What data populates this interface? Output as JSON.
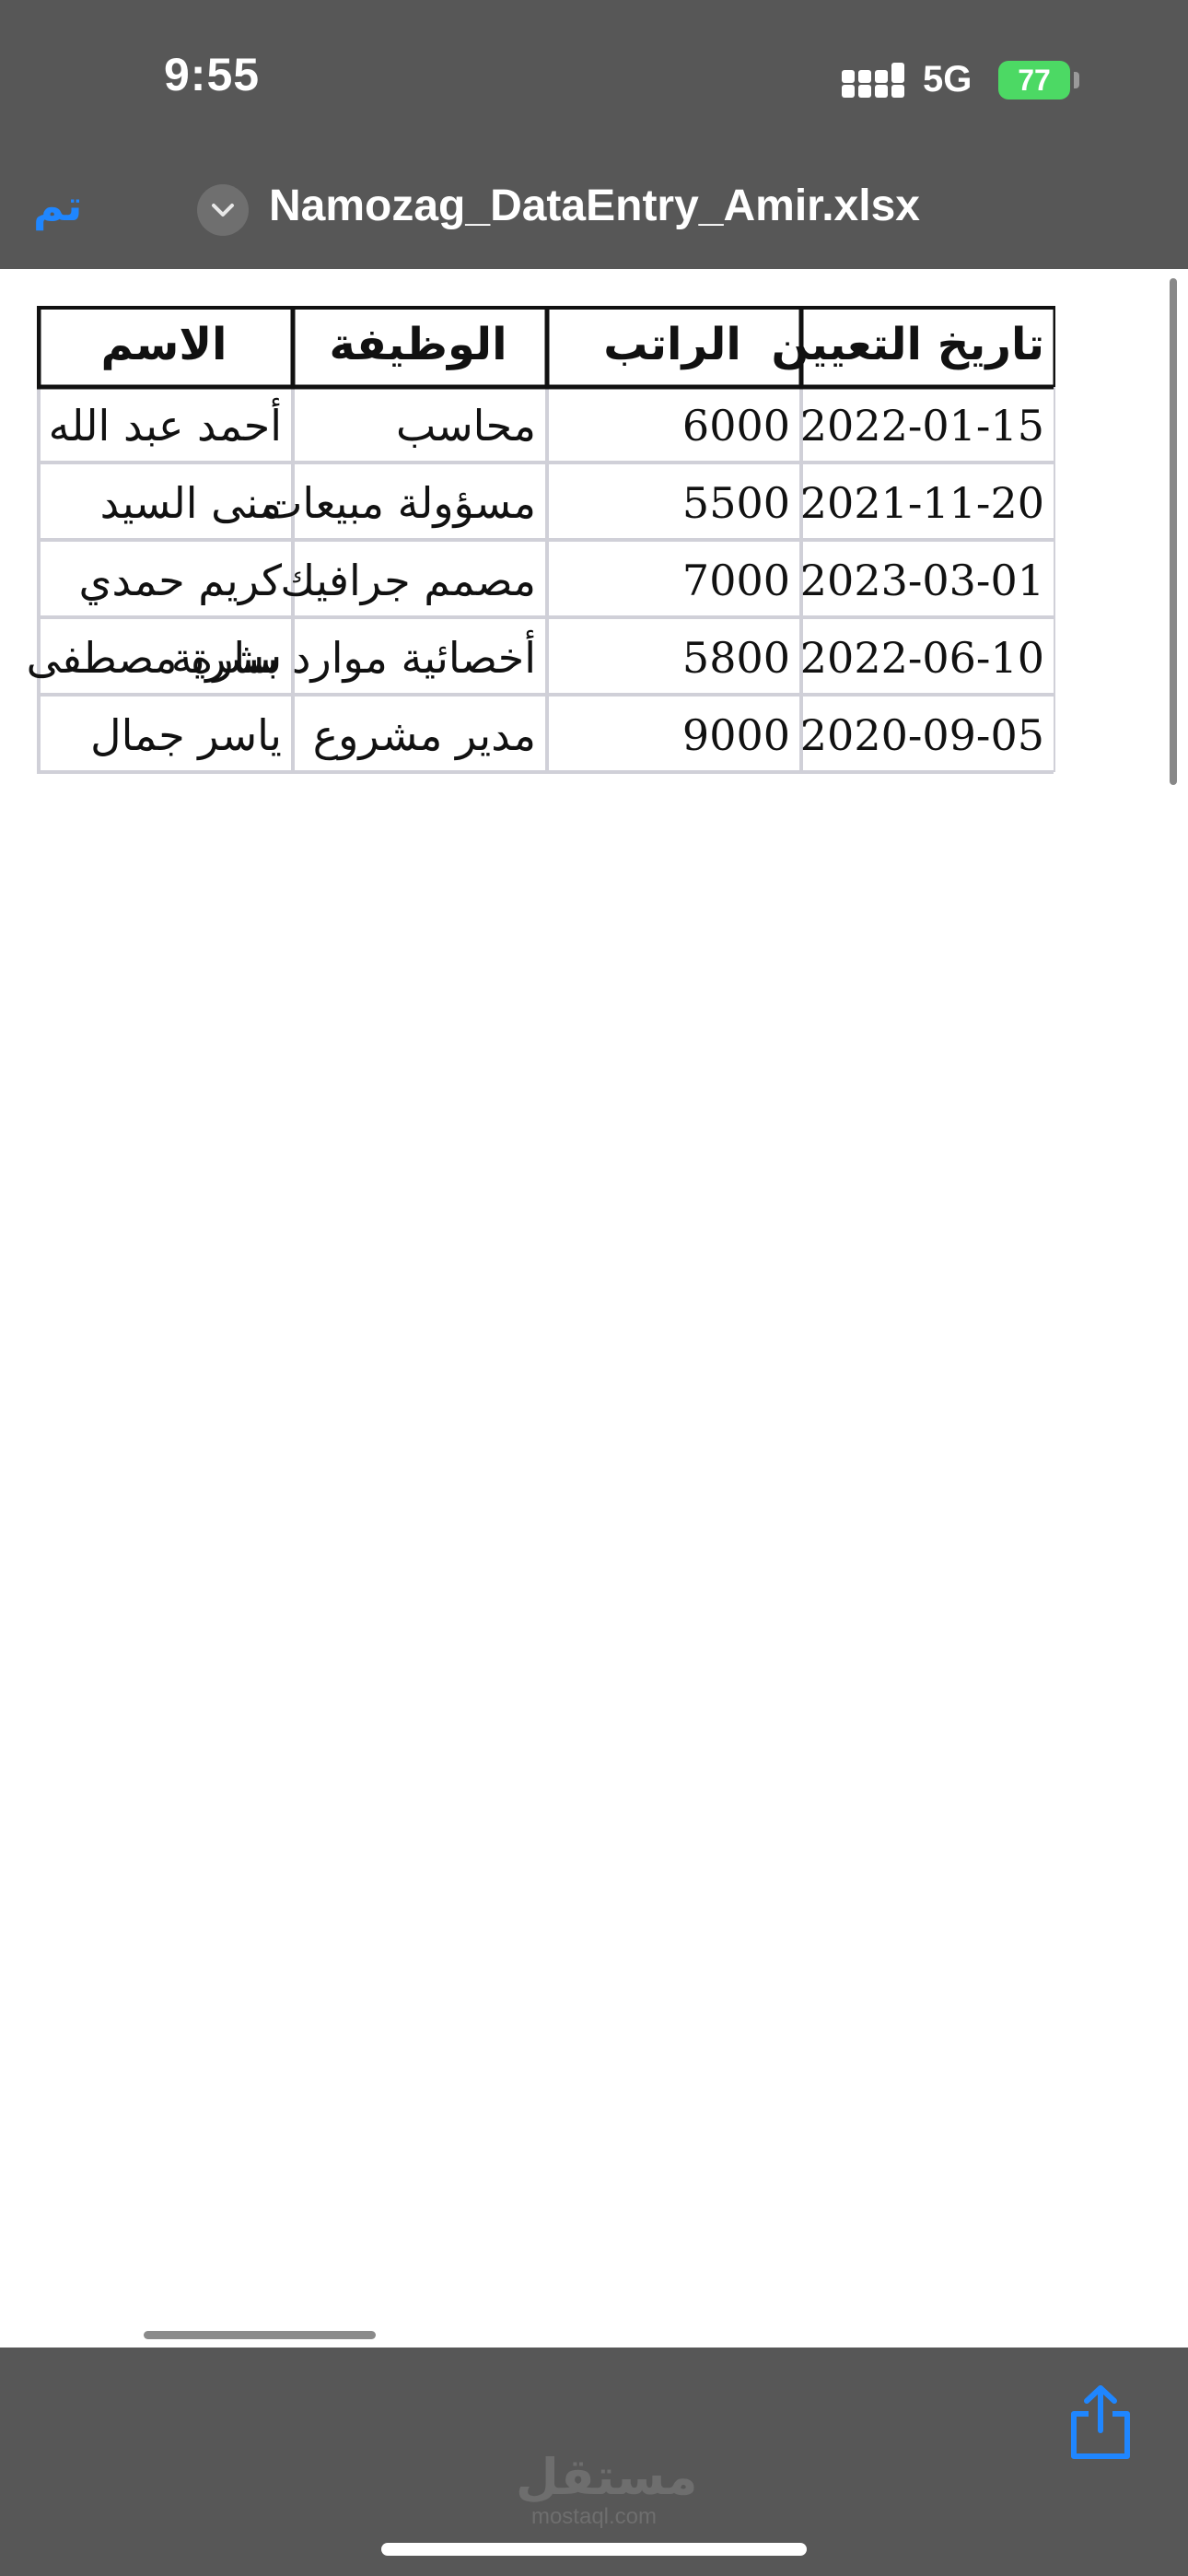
{
  "status_bar": {
    "time": "9:55",
    "network": "5G",
    "battery": "77"
  },
  "header": {
    "done_label": "تم",
    "file_name": "Namozag_DataEntry_Amir.xlsx"
  },
  "table": {
    "columns": [
      "تاريخ التعيين",
      "الراتب",
      "الوظيفة",
      "الاسم"
    ],
    "rows": [
      {
        "date": "2022-01-15",
        "salary": "6000",
        "job": "محاسب",
        "name": "أحمد عبد الله"
      },
      {
        "date": "2021-11-20",
        "salary": "5500",
        "job": "مسؤولة مبيعات",
        "name": "منى السيد"
      },
      {
        "date": "2023-03-01",
        "salary": "7000",
        "job": "مصمم جرافيك",
        "name": "كريم حمدي"
      },
      {
        "date": "2022-06-10",
        "salary": "5800",
        "job": "أخصائية موارد بشرية",
        "name": "سارة مصطفى"
      },
      {
        "date": "2020-09-05",
        "salary": "9000",
        "job": "مدير مشروع",
        "name": "ياسر جمال"
      }
    ]
  },
  "watermark": {
    "arabic": "مستقل",
    "latin": "mostaql.com"
  },
  "icons": {
    "share": "share-icon",
    "chevron": "chevron-down-icon",
    "signal": "cellular-signal-icon",
    "battery": "battery-charging-icon"
  },
  "colors": {
    "bar": "#575757",
    "accent": "#1f86ff",
    "battery": "#4cd964",
    "grid": "#d0d0d8"
  }
}
